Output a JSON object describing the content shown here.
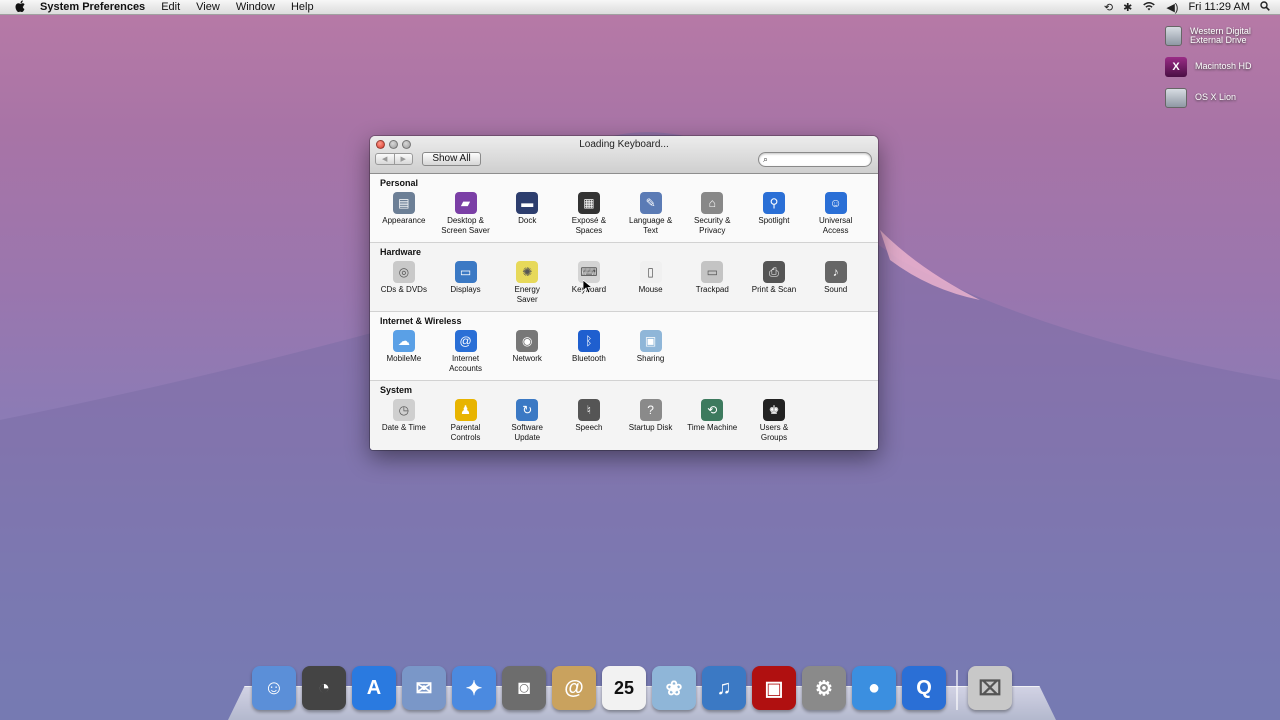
{
  "menubar": {
    "apple": "",
    "app_name": "System Preferences",
    "items": [
      "Edit",
      "View",
      "Window",
      "Help"
    ],
    "clock": "Fri 11:29 AM"
  },
  "desktop": {
    "volumes": [
      {
        "name": "Western Digital External Drive",
        "icon": "hard-drive-icon"
      },
      {
        "name": "Macintosh HD",
        "icon": "osx-drive-icon"
      },
      {
        "name": "OS X Lion",
        "icon": "disk-image-icon"
      }
    ]
  },
  "window": {
    "title": "Loading Keyboard...",
    "show_all": "Show All",
    "search_placeholder": "",
    "sections": [
      {
        "title": "Personal",
        "panes": [
          {
            "label": "Appearance",
            "icon": "appearance-icon",
            "color": "#6c7f96"
          },
          {
            "label": "Desktop &\nScreen Saver",
            "icon": "desktop-icon",
            "color": "#7b3fa6"
          },
          {
            "label": "Dock",
            "icon": "dock-icon",
            "color": "#2d3e6e"
          },
          {
            "label": "Exposé &\nSpaces",
            "icon": "expose-icon",
            "color": "#333333"
          },
          {
            "label": "Language &\nText",
            "icon": "language-icon",
            "color": "#5b7bb5"
          },
          {
            "label": "Security &\nPrivacy",
            "icon": "security-icon",
            "color": "#888888"
          },
          {
            "label": "Spotlight",
            "icon": "spotlight-icon",
            "color": "#2a6fd6"
          },
          {
            "label": "Universal\nAccess",
            "icon": "accessibility-icon",
            "color": "#2a6fd6"
          }
        ]
      },
      {
        "title": "Hardware",
        "panes": [
          {
            "label": "CDs & DVDs",
            "icon": "cd-icon",
            "color": "#c9c9c9"
          },
          {
            "label": "Displays",
            "icon": "display-icon",
            "color": "#3b79c4"
          },
          {
            "label": "Energy\nSaver",
            "icon": "lightbulb-icon",
            "color": "#e7d95a"
          },
          {
            "label": "Keyboard",
            "icon": "keyboard-icon",
            "color": "#d4d4d4"
          },
          {
            "label": "Mouse",
            "icon": "mouse-icon",
            "color": "#f0f0f0"
          },
          {
            "label": "Trackpad",
            "icon": "trackpad-icon",
            "color": "#c4c4c4"
          },
          {
            "label": "Print & Scan",
            "icon": "printer-icon",
            "color": "#555555"
          },
          {
            "label": "Sound",
            "icon": "speaker-icon",
            "color": "#666666"
          }
        ]
      },
      {
        "title": "Internet & Wireless",
        "panes": [
          {
            "label": "MobileMe",
            "icon": "cloud-icon",
            "color": "#5aa0e6"
          },
          {
            "label": "Internet\nAccounts",
            "icon": "at-icon",
            "color": "#2a6fd6"
          },
          {
            "label": "Network",
            "icon": "globe-icon",
            "color": "#777777"
          },
          {
            "label": "Bluetooth",
            "icon": "bluetooth-icon",
            "color": "#1f5fcf"
          },
          {
            "label": "Sharing",
            "icon": "sharing-folder-icon",
            "color": "#8fb6d8"
          }
        ]
      },
      {
        "title": "System",
        "panes": [
          {
            "label": "Date & Time",
            "icon": "clock-icon",
            "color": "#cfcfcf"
          },
          {
            "label": "Parental\nControls",
            "icon": "parental-icon",
            "color": "#e8b400"
          },
          {
            "label": "Software\nUpdate",
            "icon": "update-icon",
            "color": "#3b79c4"
          },
          {
            "label": "Speech",
            "icon": "microphone-icon",
            "color": "#555555"
          },
          {
            "label": "Startup Disk",
            "icon": "startup-disk-icon",
            "color": "#8a8a8a"
          },
          {
            "label": "Time Machine",
            "icon": "time-machine-icon",
            "color": "#3d7a5e"
          },
          {
            "label": "Users &\nGroups",
            "icon": "users-icon",
            "color": "#222222"
          }
        ]
      }
    ]
  },
  "dock": {
    "items": [
      {
        "name": "finder",
        "icon": "finder-icon",
        "color": "#5b8fd8"
      },
      {
        "name": "dashboard",
        "icon": "dashboard-icon",
        "color": "#444444"
      },
      {
        "name": "app-store",
        "icon": "app-store-icon",
        "color": "#2a7ae0"
      },
      {
        "name": "mail",
        "icon": "mail-icon",
        "color": "#7a97c8"
      },
      {
        "name": "safari",
        "icon": "safari-icon",
        "color": "#4b8ae0"
      },
      {
        "name": "facetime",
        "icon": "facetime-icon",
        "color": "#6d6d6d"
      },
      {
        "name": "address-book",
        "icon": "address-book-icon",
        "color": "#c9a25e"
      },
      {
        "name": "ical",
        "icon": "calendar-icon",
        "color": "#f2f2f2",
        "text": "25"
      },
      {
        "name": "iphoto",
        "icon": "iphoto-icon",
        "color": "#8fb6d8"
      },
      {
        "name": "itunes",
        "icon": "itunes-icon",
        "color": "#3b79c4"
      },
      {
        "name": "photo-booth",
        "icon": "photo-booth-icon",
        "color": "#b01010"
      },
      {
        "name": "system-preferences",
        "icon": "gear-icon",
        "color": "#8a8a8a"
      },
      {
        "name": "ichat",
        "icon": "chat-bubble-icon",
        "color": "#3b8fe0"
      },
      {
        "name": "quicktime",
        "icon": "quicktime-icon",
        "color": "#2a6fd6"
      }
    ],
    "trash": {
      "name": "trash",
      "icon": "trash-icon",
      "color": "#c8c8c8"
    }
  }
}
